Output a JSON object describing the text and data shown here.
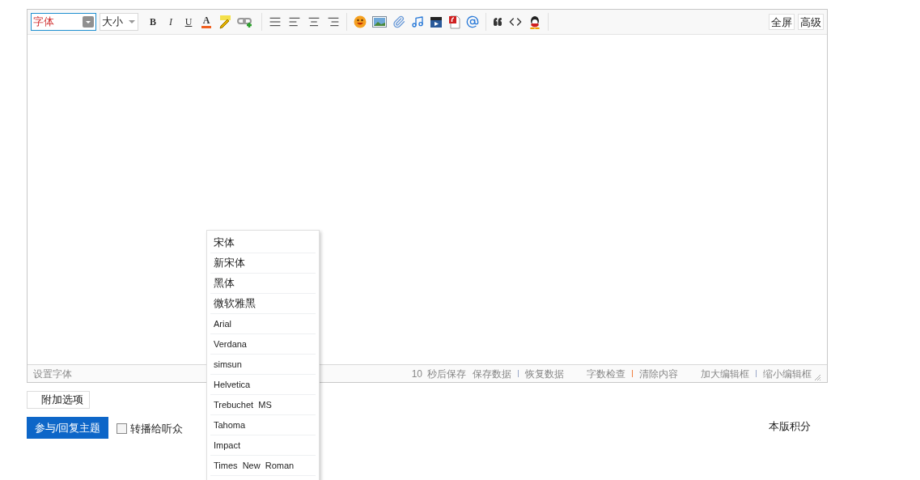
{
  "toolbar": {
    "font_select": {
      "value": "字体"
    },
    "size_select": {
      "value": "大小"
    },
    "format_buttons": [
      "B",
      "I",
      "U",
      "A"
    ],
    "right_buttons": [
      "全屏",
      "高级"
    ]
  },
  "font_menu": {
    "items": [
      {
        "label": "宋体",
        "kind": "cjk"
      },
      {
        "label": "新宋体",
        "kind": "cjk"
      },
      {
        "label": "黑体",
        "kind": "cjk"
      },
      {
        "label": "微软雅黑",
        "kind": "cjk"
      },
      {
        "label": "Arial",
        "kind": "latin"
      },
      {
        "label": "Verdana",
        "kind": "latin"
      },
      {
        "label": "simsun",
        "kind": "latin"
      },
      {
        "label": "Helvetica",
        "kind": "latin"
      },
      {
        "label": "Trebuchet  MS",
        "kind": "latin"
      },
      {
        "label": "Tahoma",
        "kind": "latin"
      },
      {
        "label": "Impact",
        "kind": "latin"
      },
      {
        "label": "Times  New  Roman",
        "kind": "latin"
      }
    ]
  },
  "status_bar": {
    "hint": "设置字体",
    "autosave_count": "10",
    "autosave_label": "秒后保存",
    "groups": [
      {
        "actions": [
          "保存数据",
          "恢复数据"
        ],
        "color": "#9aa8c8"
      },
      {
        "actions": [
          "字数检查",
          "清除内容"
        ],
        "color": "#f08040"
      },
      {
        "actions": [
          "加大编辑框",
          "缩小编辑框"
        ],
        "color": "#9aa8c8"
      }
    ]
  },
  "extra_options_button": "附加选项",
  "submit_button": "参与/回复主题",
  "broadcast_checkbox": {
    "label": "转播给听众",
    "checked": false
  },
  "board_points_label": "本版积分"
}
